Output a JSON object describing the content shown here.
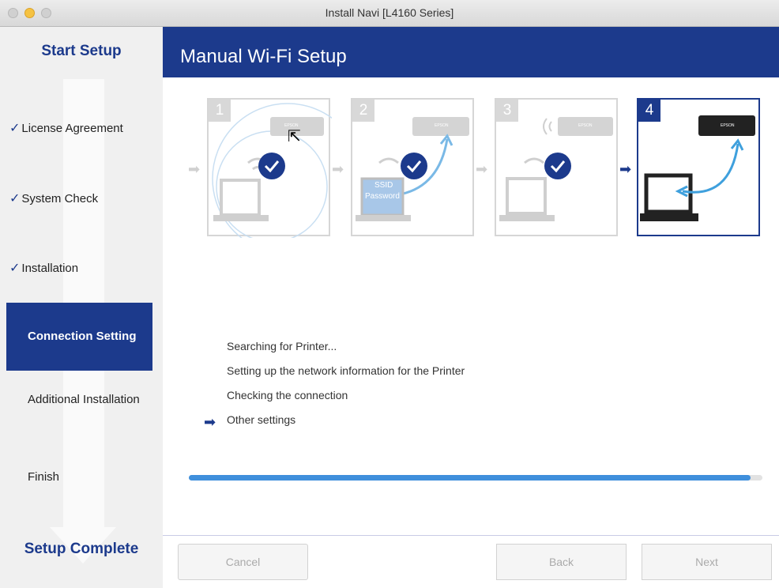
{
  "window": {
    "title": "Install Navi [L4160 Series]"
  },
  "sidebar": {
    "start": "Start Setup",
    "complete": "Setup Complete",
    "items": [
      {
        "label": "License Agreement",
        "status": "done"
      },
      {
        "label": "System Check",
        "status": "done"
      },
      {
        "label": "Installation",
        "status": "done"
      },
      {
        "label": "Connection Setting",
        "status": "current"
      },
      {
        "label": "Additional Installation",
        "status": "pending"
      },
      {
        "label": "Finish",
        "status": "pending"
      }
    ]
  },
  "header": {
    "title": "Manual Wi-Fi Setup"
  },
  "steps": [
    {
      "number": "1",
      "printer_label": "EPSON",
      "state": "done"
    },
    {
      "number": "2",
      "printer_label": "EPSON",
      "state": "done",
      "ssid_text": "SSID",
      "password_text": "Password"
    },
    {
      "number": "3",
      "printer_label": "EPSON",
      "state": "done"
    },
    {
      "number": "4",
      "printer_label": "EPSON",
      "state": "current"
    }
  ],
  "status_list": [
    "Searching for Printer...",
    "Setting up the network information for the Printer",
    "Checking the connection",
    "Other settings"
  ],
  "progress": {
    "percent": 98
  },
  "buttons": {
    "cancel": "Cancel",
    "back": "Back",
    "next": "Next"
  },
  "colors": {
    "accent": "#1c3a8c",
    "progress": "#3f8fdc",
    "checkmark": "#1c3a8c"
  }
}
